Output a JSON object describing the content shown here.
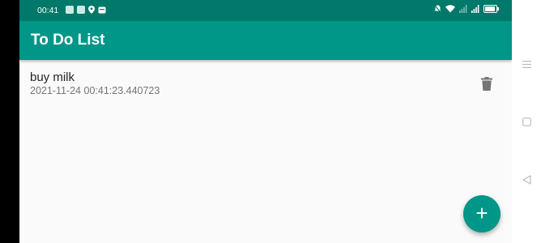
{
  "status_bar": {
    "time": "00:41",
    "left_icons": [
      "notification-icon",
      "notification-icon",
      "location-icon",
      "message-icon"
    ],
    "right_icons": [
      "mute-icon",
      "wifi-icon",
      "signal-icon",
      "signal-icon",
      "battery-icon"
    ],
    "battery_level": 0.9
  },
  "app_bar": {
    "title": "To Do List"
  },
  "todos": [
    {
      "title": "buy milk",
      "timestamp": "2021-11-24 00:41:23.440723"
    }
  ],
  "fab": {
    "label": "+"
  },
  "nav_bar": {
    "buttons": [
      "menu-icon",
      "home-icon",
      "back-icon"
    ]
  },
  "colors": {
    "primary": "#009688",
    "primary_dark": "#00786a",
    "background": "#fafafa",
    "subtitle": "#757575"
  }
}
